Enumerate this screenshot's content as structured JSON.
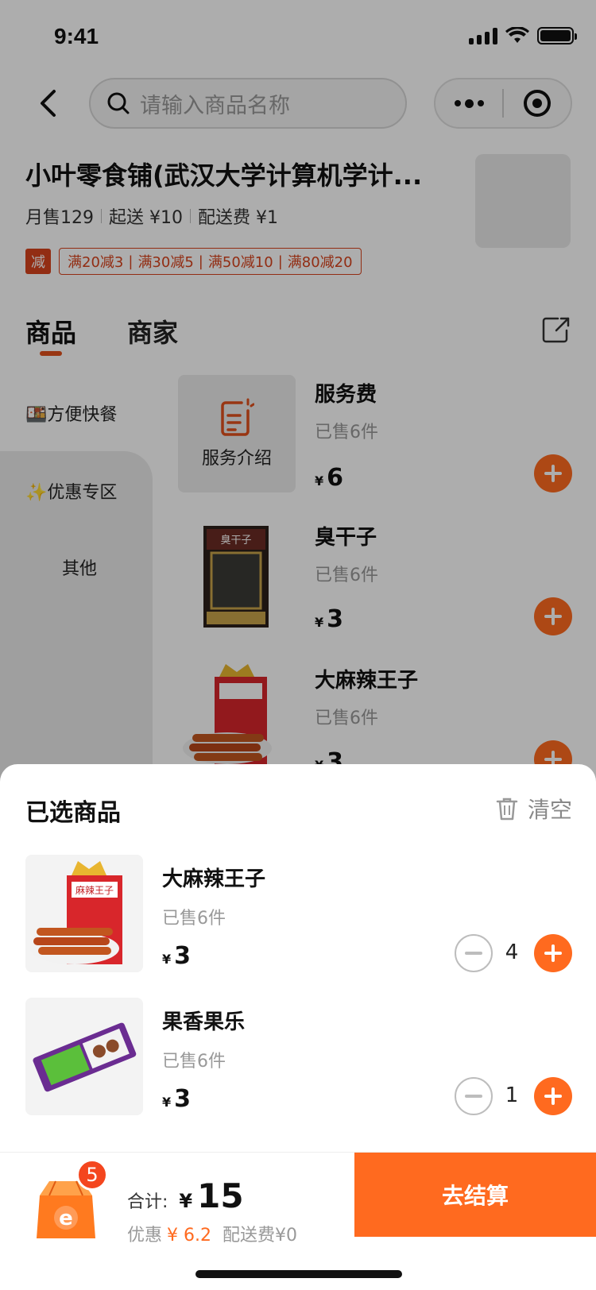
{
  "status_bar": {
    "time": "9:41"
  },
  "nav": {
    "search_placeholder": "请输入商品名称"
  },
  "shop": {
    "name": "小叶零食铺(武汉大学计算机学计...",
    "monthly_sales": "月售129",
    "min_order": "起送 ¥10",
    "delivery_fee": "配送费 ¥1",
    "promo_tag": "减",
    "promos": [
      "满20减3",
      "满30减5",
      "满50减10",
      "满80减20"
    ]
  },
  "tabs": {
    "goods": "商品",
    "merchant": "商家"
  },
  "categories": [
    "🍱方便快餐",
    "✨优惠专区",
    "其他"
  ],
  "products": [
    {
      "name": "服务费",
      "sold": "已售6件",
      "currency": "¥",
      "price": "6",
      "image_label": "服务介绍"
    },
    {
      "name": "臭干子",
      "sold": "已售6件",
      "currency": "¥",
      "price": "3"
    },
    {
      "name": "大麻辣王子",
      "sold": "已售6件",
      "currency": "¥",
      "price": "3"
    }
  ],
  "cart": {
    "title": "已选商品",
    "clear_label": "清空",
    "items": [
      {
        "name": "大麻辣王子",
        "sold": "已售6件",
        "currency": "¥",
        "price": "3",
        "qty": "4"
      },
      {
        "name": "果香果乐",
        "sold": "已售6件",
        "currency": "¥",
        "price": "3",
        "qty": "1"
      }
    ]
  },
  "summary": {
    "badge_count": "5",
    "bag_letter": "e",
    "total_label": "合计:",
    "total_currency": "¥",
    "total_value": "15",
    "discount_label": "优惠",
    "discount_value": "¥ 6.2",
    "delivery_fee": "配送费¥0",
    "checkout_label": "去结算"
  },
  "colors": {
    "accent": "#ff6a1f",
    "promo": "#d8431c",
    "badge": "#f4461e"
  }
}
